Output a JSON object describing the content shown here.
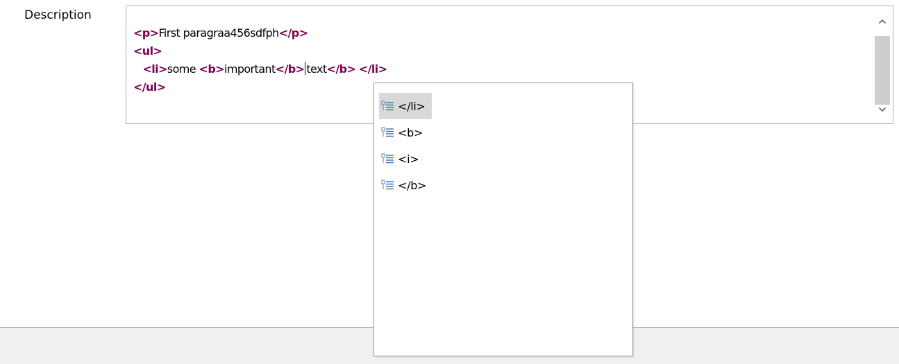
{
  "field": {
    "label": "Description"
  },
  "editor": {
    "lines": [
      [
        {
          "t": "tag",
          "v": "<p>"
        },
        {
          "t": "txt",
          "v": "First paragraa456sdfph"
        },
        {
          "t": "tag",
          "v": "</p>"
        }
      ],
      [
        {
          "t": "tag",
          "v": "<ul>"
        }
      ],
      [
        {
          "t": "txt",
          "v": "   "
        },
        {
          "t": "tag",
          "v": "<li>"
        },
        {
          "t": "txt",
          "v": "some "
        },
        {
          "t": "tag",
          "v": "<b>"
        },
        {
          "t": "txt",
          "v": "important"
        },
        {
          "t": "tag",
          "v": "</b>"
        },
        {
          "t": "caret"
        },
        {
          "t": "txt",
          "v": "text"
        },
        {
          "t": "tag",
          "v": "</b>"
        },
        {
          "t": "txt",
          "v": " "
        },
        {
          "t": "tag",
          "v": "</li>"
        }
      ],
      [
        {
          "t": "tag",
          "v": "</ul>"
        }
      ]
    ]
  },
  "scrollbar": {
    "up_icon": "chevron-up-icon",
    "down_icon": "chevron-down-icon"
  },
  "autocomplete": {
    "selected_index": 0,
    "item_icon": "template-proposal-icon",
    "items": [
      {
        "label": "</li>"
      },
      {
        "label": "<b>"
      },
      {
        "label": "<i>"
      },
      {
        "label": "</b>"
      }
    ]
  },
  "colors": {
    "tag": "#7f0055",
    "text": "#000000",
    "selection": "#d9d9d9",
    "scroll_thumb": "#cdcdcd",
    "footer": "#f0f0f0"
  }
}
